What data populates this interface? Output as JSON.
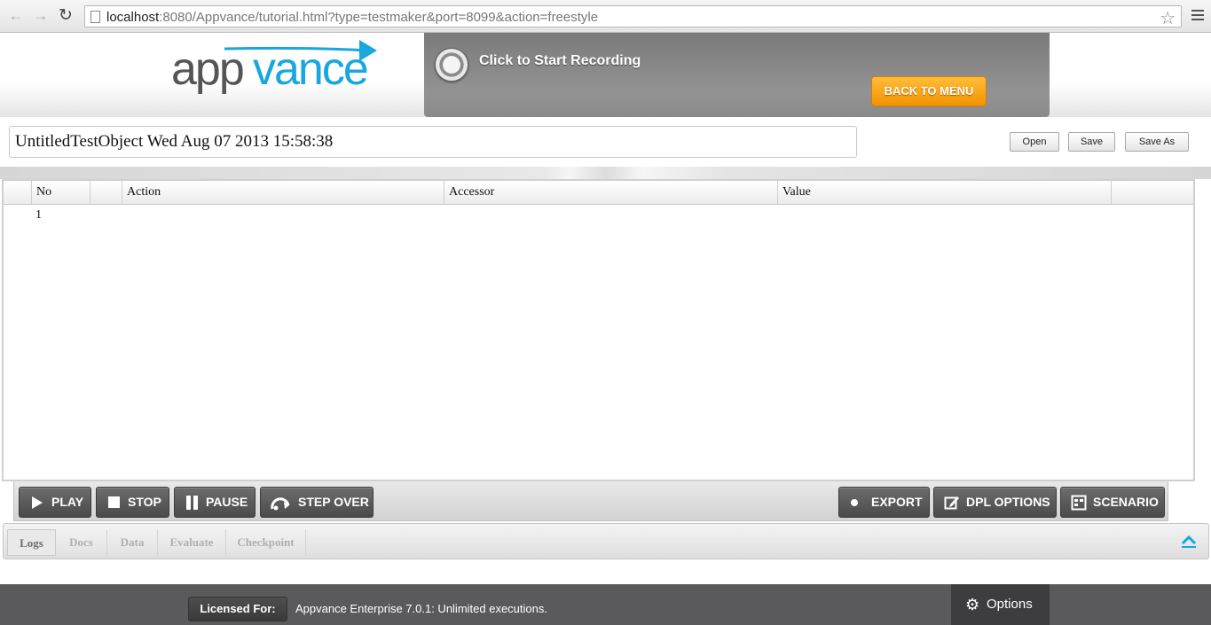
{
  "browser": {
    "url_host": "localhost",
    "url_rest": ":8080/Appvance/tutorial.html?type=testmaker&port=8099&action=freestyle"
  },
  "header": {
    "logo_text_dark": "app",
    "logo_text_blue": "vance",
    "record_label": "Click to Start Recording",
    "back_button": "BACK TO MENU"
  },
  "test": {
    "title": "UntitledTestObject Wed Aug 07 2013 15:58:38",
    "open_label": "Open",
    "save_label": "Save",
    "save_as_label": "Save As"
  },
  "grid": {
    "columns": [
      "No",
      "",
      "Action",
      "Accessor",
      "Value",
      ""
    ],
    "rows": [
      {
        "no": "1",
        "action": "",
        "accessor": "",
        "value": ""
      }
    ]
  },
  "toolbar": {
    "play": "PLAY",
    "stop": "STOP",
    "pause": "PAUSE",
    "step_over": "STEP OVER",
    "export": "EXPORT",
    "dpl_options": "DPL OPTIONS",
    "scenario": "SCENARIO"
  },
  "tabs": [
    "Logs",
    "Docs",
    "Data",
    "Evaluate",
    "Checkpoint"
  ],
  "footer": {
    "licensed_for": "Licensed For:",
    "license_text": "Appvance Enterprise 7.0.1: Unlimited executions.",
    "options": "Options"
  },
  "colors": {
    "brand_blue": "#1aa6de",
    "brand_dark": "#555555",
    "orange": "#f39300"
  }
}
